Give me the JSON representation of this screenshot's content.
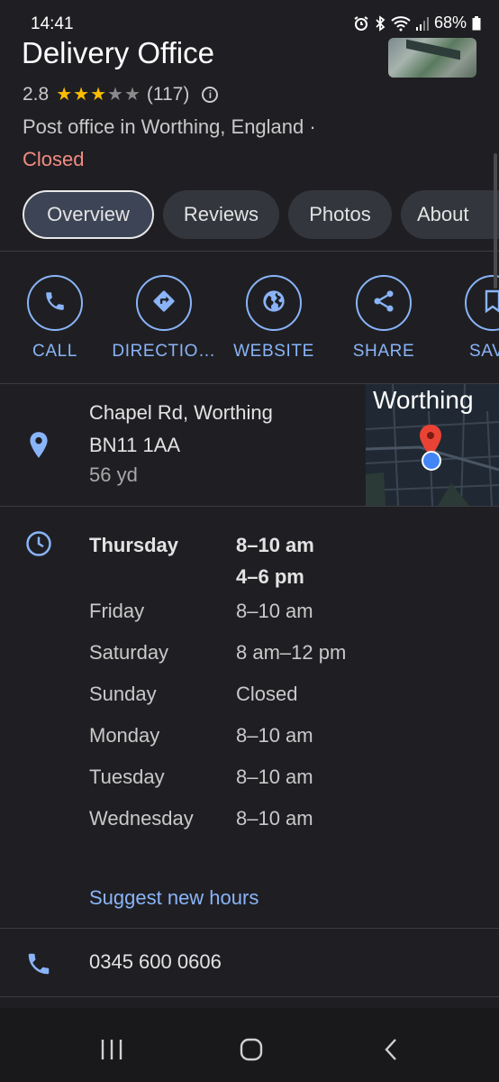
{
  "status_bar": {
    "time": "14:41",
    "battery": "68%"
  },
  "place": {
    "title": "Delivery Office",
    "rating": "2.8",
    "review_count": "(117)",
    "stars_filled": 3,
    "category": "Post office in Worthing, England ·",
    "open_status": "Closed"
  },
  "tabs": [
    {
      "label": "Overview",
      "active": true
    },
    {
      "label": "Reviews"
    },
    {
      "label": "Photos"
    },
    {
      "label": "About"
    }
  ],
  "actions": [
    {
      "label": "CALL",
      "icon": "phone-icon"
    },
    {
      "label": "DIRECTIO…",
      "icon": "directions-icon"
    },
    {
      "label": "WEBSITE",
      "icon": "globe-icon"
    },
    {
      "label": "SHARE",
      "icon": "share-icon"
    },
    {
      "label": "SAV",
      "icon": "bookmark-icon"
    }
  ],
  "address": {
    "line1": "Chapel Rd, Worthing",
    "line2": "BN11 1AA",
    "distance": "56 yd",
    "map_label": "Worthing"
  },
  "hours": [
    {
      "day": "Thursday",
      "hours": [
        "8–10 am",
        "4–6 pm"
      ],
      "today": true
    },
    {
      "day": "Friday",
      "hours": [
        "8–10 am"
      ]
    },
    {
      "day": "Saturday",
      "hours": [
        "8 am–12 pm"
      ]
    },
    {
      "day": "Sunday",
      "hours": [
        "Closed"
      ]
    },
    {
      "day": "Monday",
      "hours": [
        "8–10 am"
      ]
    },
    {
      "day": "Tuesday",
      "hours": [
        "8–10 am"
      ]
    },
    {
      "day": "Wednesday",
      "hours": [
        "8–10 am"
      ]
    }
  ],
  "suggest_hours_label": "Suggest new hours",
  "phone": "0345 600 0606",
  "colors": {
    "accent": "#8ab4f8",
    "closed": "#f28b82",
    "star": "#fbbc04",
    "background": "#1f1f23"
  }
}
